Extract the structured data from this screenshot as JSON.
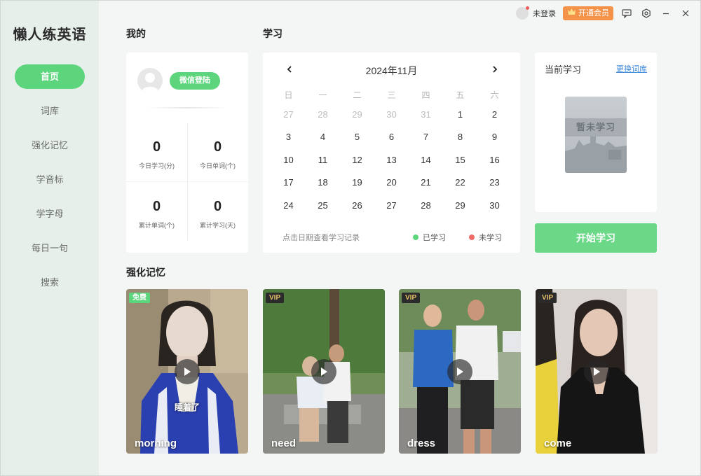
{
  "app": {
    "logo": "懒人练英语"
  },
  "titlebar": {
    "user_label": "未登录",
    "vip_label": "开通会员"
  },
  "sidebar": {
    "items": [
      {
        "label": "首页",
        "active": true
      },
      {
        "label": "词库"
      },
      {
        "label": "强化记忆"
      },
      {
        "label": "学音标"
      },
      {
        "label": "学字母"
      },
      {
        "label": "每日一句"
      },
      {
        "label": "搜索"
      }
    ]
  },
  "profile": {
    "section_title": "我的",
    "login_button": "微信登陆",
    "stats": [
      {
        "value": "0",
        "label": "今日学习(分)"
      },
      {
        "value": "0",
        "label": "今日单词(个)"
      },
      {
        "value": "0",
        "label": "累计单词(个)"
      },
      {
        "value": "0",
        "label": "累计学习(天)"
      }
    ]
  },
  "study": {
    "section_title": "学习",
    "calendar": {
      "title": "2024年11月",
      "weekdays": [
        "日",
        "一",
        "二",
        "三",
        "四",
        "五",
        "六"
      ],
      "weeks": [
        [
          "27",
          "28",
          "29",
          "30",
          "31",
          "1",
          "2"
        ],
        [
          "3",
          "4",
          "5",
          "6",
          "7",
          "8",
          "9"
        ],
        [
          "10",
          "11",
          "12",
          "13",
          "14",
          "15",
          "16"
        ],
        [
          "17",
          "18",
          "19",
          "20",
          "21",
          "22",
          "23"
        ],
        [
          "24",
          "25",
          "26",
          "27",
          "28",
          "29",
          "30"
        ]
      ],
      "hint": "点击日期查看学习记录",
      "legend_learned": "已学习",
      "legend_not_learned": "未学习",
      "color_learned": "#5dd57c",
      "color_not_learned": "#f06a6a"
    }
  },
  "current": {
    "title": "当前学习",
    "change_link": "更换词库",
    "book_label": "暂未学习",
    "start_button": "开始学习"
  },
  "memory": {
    "section_title": "强化记忆",
    "videos": [
      {
        "badge": "免费",
        "word": "morning",
        "subtitle": "睡着了"
      },
      {
        "badge": "VIP",
        "word": "need"
      },
      {
        "badge": "VIP",
        "word": "dress"
      },
      {
        "badge": "VIP",
        "word": "come"
      }
    ]
  },
  "colors": {
    "accent": "#5dd57c",
    "vip": "#f5924a",
    "link": "#3a86d8"
  }
}
